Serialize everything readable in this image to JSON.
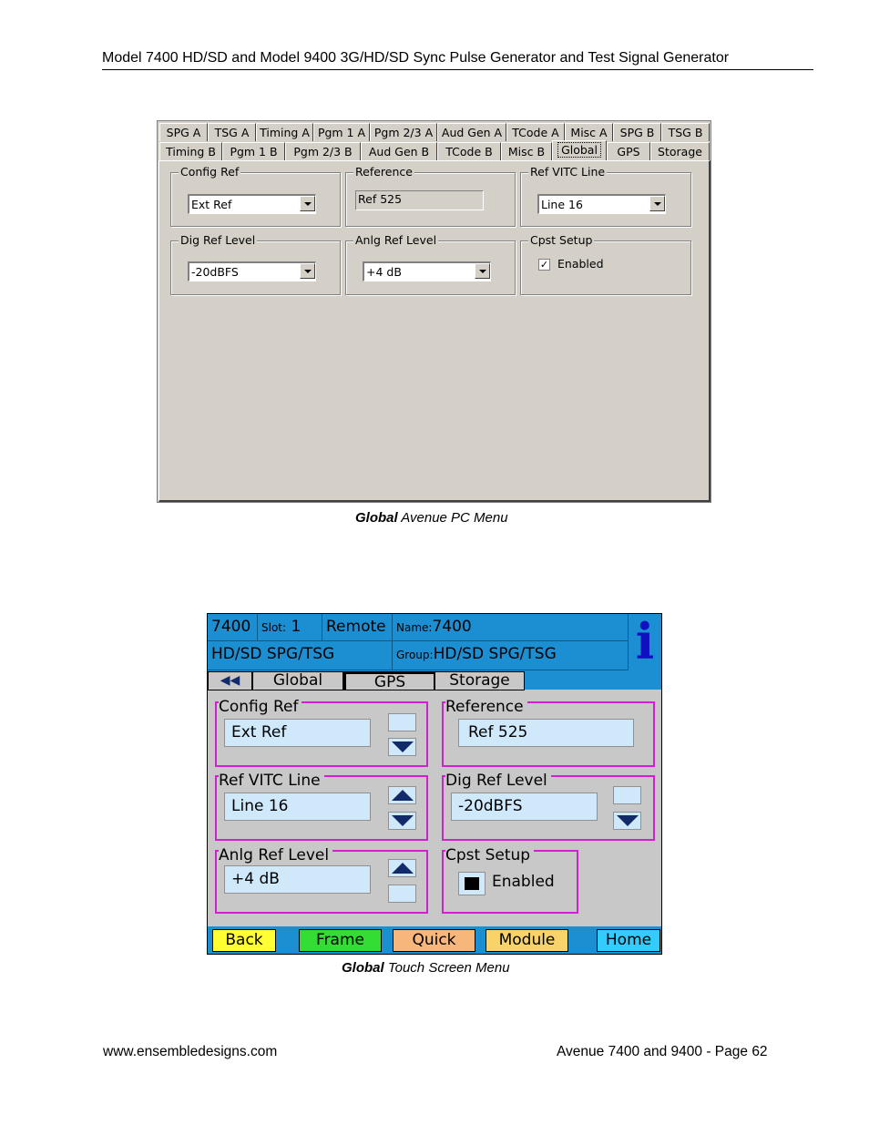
{
  "header": {
    "title": "Model 7400 HD/SD and Model 9400 3G/HD/SD Sync Pulse Generator and Test Signal Generator"
  },
  "pc_menu": {
    "tabs_row1": [
      "SPG A",
      "TSG A",
      "Timing A",
      "Pgm 1 A",
      "Pgm 2/3 A",
      "Aud Gen A",
      "TCode A",
      "Misc A",
      "SPG B",
      "TSG B"
    ],
    "tabs_row2": [
      "Timing B",
      "Pgm 1 B",
      "Pgm 2/3 B",
      "Aud Gen B",
      "TCode B",
      "Misc B",
      "Global",
      "GPS",
      "Storage"
    ],
    "active_tab": "Global",
    "config_ref": {
      "label": "Config Ref",
      "value": "Ext Ref"
    },
    "reference": {
      "label": "Reference",
      "value": "Ref 525"
    },
    "ref_vitc_line": {
      "label": "Ref VITC Line",
      "value": "Line 16"
    },
    "dig_ref_level": {
      "label": "Dig Ref Level",
      "value": "-20dBFS"
    },
    "anlg_ref_level": {
      "label": "Anlg Ref Level",
      "value": "+4  dB"
    },
    "cpst_setup": {
      "label": "Cpst Setup",
      "checkbox_label": "Enabled",
      "checked": true
    }
  },
  "caption1": {
    "bold": "Global",
    "rest": " Avenue PC Menu"
  },
  "touch_screen": {
    "model": "7400",
    "slot_label": "Slot:",
    "slot_value": "1",
    "mode": "Remote",
    "name_label": "Name:",
    "name_value": "7400",
    "product": "HD/SD SPG/TSG",
    "group_label": "Group:",
    "group_value": "HD/SD SPG/TSG",
    "info_icon": "i",
    "nav_back_icon": "◀◀",
    "tabs": [
      "Global",
      "GPS",
      "Storage"
    ],
    "config_ref": {
      "label": "Config Ref",
      "value": "Ext Ref"
    },
    "reference": {
      "label": "Reference",
      "value": "Ref 525"
    },
    "ref_vitc_line": {
      "label": "Ref VITC Line",
      "value": "Line 16"
    },
    "dig_ref_level": {
      "label": "Dig Ref Level",
      "value": "-20dBFS"
    },
    "anlg_ref_level": {
      "label": "Anlg Ref Level",
      "value": "+4  dB"
    },
    "cpst_setup": {
      "label": "Cpst Setup",
      "checkbox_label": "Enabled"
    },
    "buttons": {
      "back": "Back",
      "frame": "Frame",
      "quick": "Quick",
      "module": "Module",
      "home": "Home"
    },
    "colors": {
      "back": "#ffff33",
      "frame": "#33dd33",
      "quick": "#f7b77a",
      "module": "#f7d36a",
      "home": "#33ccff",
      "bar": "#1b8fd2"
    }
  },
  "caption2": {
    "bold": "Global",
    "rest": " Touch Screen Menu"
  },
  "footer": {
    "left": "www.ensembledesigns.com",
    "right": "Avenue 7400 and 9400 - Page 62"
  }
}
